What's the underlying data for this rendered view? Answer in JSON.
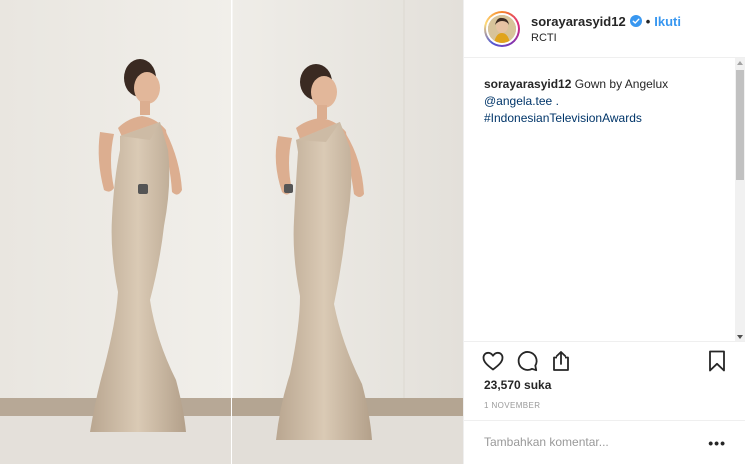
{
  "post": {
    "author": "sorayarasyid12",
    "follow_label": "Ikuti",
    "separator": "•",
    "location": "RCTI",
    "caption": {
      "username": "sorayarasyid12",
      "text": " Gown by Angelux",
      "mention": "@angela.tee .",
      "hashtag": "#IndonesianTelevisionAwards"
    },
    "likes": "23,570 suka",
    "date": "1 NOVEMBER",
    "comment_placeholder": "Tambahkan komentar...",
    "more_label": "•••"
  },
  "colors": {
    "link": "#003569",
    "follow": "#3897f0",
    "verified": "#3897f0",
    "gown": "#cbb9a3",
    "wall": "#eceae5"
  },
  "icons": {
    "like": "heart-icon",
    "comment": "comment-icon",
    "share": "share-icon",
    "save": "bookmark-icon",
    "verified": "verified-badge-icon"
  }
}
